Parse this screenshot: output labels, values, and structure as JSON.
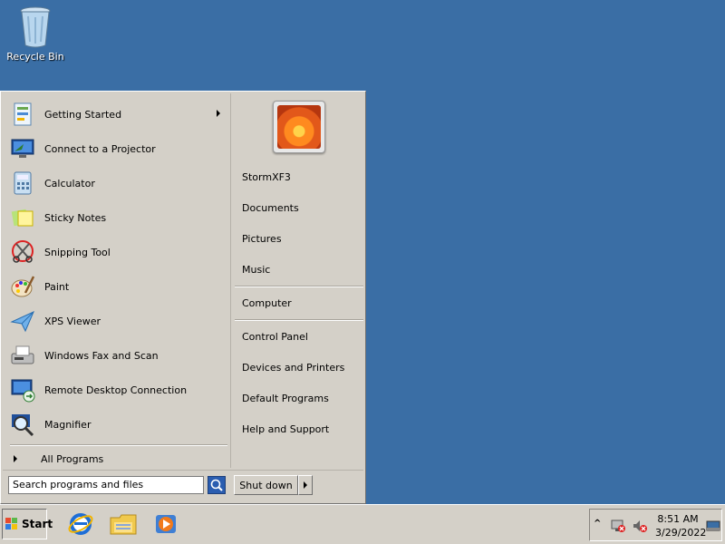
{
  "desktop": {
    "recycle_bin_label": "Recycle Bin"
  },
  "start_menu": {
    "programs": [
      {
        "label": "Getting Started",
        "icon": "getting-started-icon",
        "has_submenu": true
      },
      {
        "label": "Connect to a Projector",
        "icon": "projector-icon"
      },
      {
        "label": "Calculator",
        "icon": "calculator-icon"
      },
      {
        "label": "Sticky Notes",
        "icon": "sticky-notes-icon"
      },
      {
        "label": "Snipping Tool",
        "icon": "snipping-tool-icon"
      },
      {
        "label": "Paint",
        "icon": "paint-icon"
      },
      {
        "label": "XPS Viewer",
        "icon": "xps-viewer-icon"
      },
      {
        "label": "Windows Fax and Scan",
        "icon": "fax-scan-icon"
      },
      {
        "label": "Remote Desktop Connection",
        "icon": "remote-desktop-icon"
      },
      {
        "label": "Magnifier",
        "icon": "magnifier-icon"
      }
    ],
    "all_programs_label": "All Programs",
    "search_placeholder": "Search programs and files",
    "shutdown_label": "Shut down",
    "right": {
      "user_name": "StormXF3",
      "documents": "Documents",
      "pictures": "Pictures",
      "music": "Music",
      "computer": "Computer",
      "control_panel": "Control Panel",
      "devices_printers": "Devices and Printers",
      "default_programs": "Default Programs",
      "help_support": "Help and Support"
    }
  },
  "taskbar": {
    "start_label": "Start",
    "quick_launch": [
      "internet-explorer-icon",
      "windows-explorer-icon",
      "media-player-icon"
    ],
    "clock_time": "8:51 AM",
    "clock_date": "3/29/2022"
  },
  "colors": {
    "desktop_bg": "#3a6ea5",
    "chrome": "#d4d0c8"
  }
}
